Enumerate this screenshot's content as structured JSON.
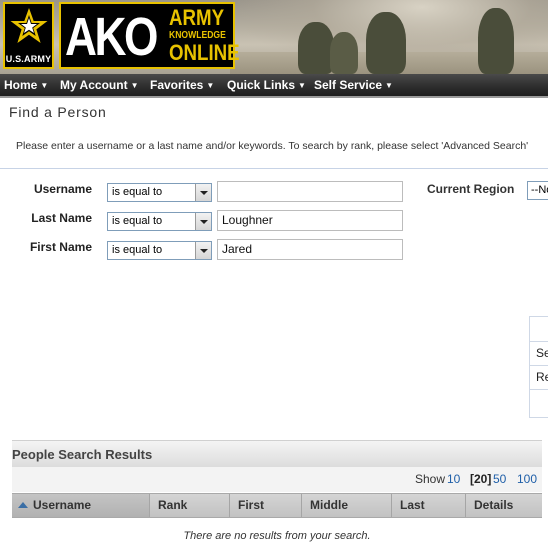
{
  "header": {
    "star_logo_text": "U.S.ARMY",
    "ako_text": "AKO",
    "ako_line1": "ARMY",
    "ako_line2": "KNOWLEDGE",
    "ako_line3": "ONLINE",
    "colors": {
      "gold": "#e8c200",
      "black": "#000000"
    }
  },
  "nav": {
    "items": [
      {
        "label": "Home"
      },
      {
        "label": "My Account"
      },
      {
        "label": "Favorites"
      },
      {
        "label": "Quick Links"
      },
      {
        "label": "Self Service"
      }
    ]
  },
  "page": {
    "title": "Find a Person",
    "instructions": "Please enter a username or a last name and/or keywords. To search by rank, please select 'Advanced Search'"
  },
  "form": {
    "username": {
      "label": "Username",
      "operator": "is equal to",
      "value": ""
    },
    "lastname": {
      "label": "Last Name",
      "operator": "is equal to",
      "value": "Loughner"
    },
    "firstname": {
      "label": "First Name",
      "operator": "is equal to",
      "value": "Jared"
    },
    "region": {
      "label": "Current Region",
      "value": "--No"
    }
  },
  "side_panel": {
    "rows": [
      "Se",
      "Re"
    ]
  },
  "results": {
    "title": "People Search Results",
    "pager": {
      "show_label": "Show",
      "options": [
        "10",
        "[20]",
        "50",
        "100"
      ],
      "current": "[20]"
    },
    "columns": [
      "Username",
      "Rank",
      "First",
      "Middle",
      "Last",
      "Details"
    ],
    "empty_message": "There are no results from your search."
  }
}
